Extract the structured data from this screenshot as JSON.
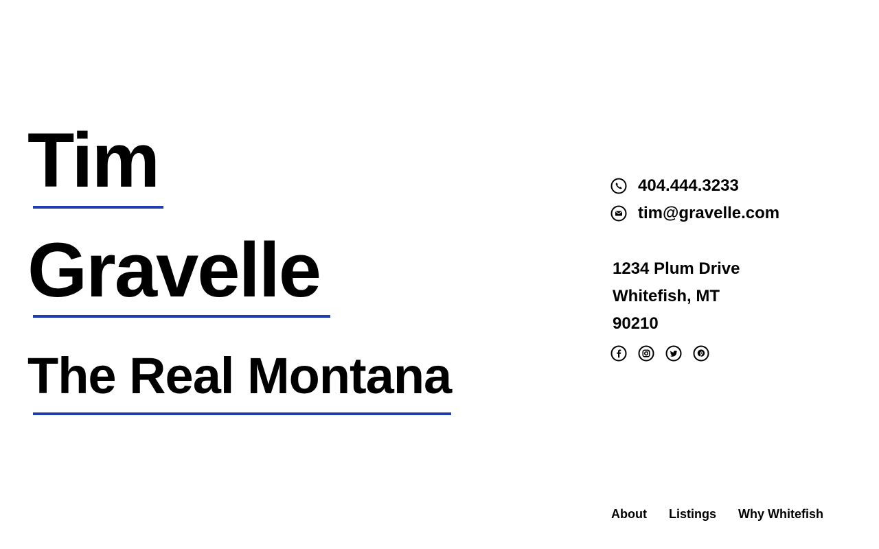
{
  "hero": {
    "first_name": "Tim",
    "last_name": "Gravelle",
    "tagline": "The Real Montana"
  },
  "contact": {
    "phone": "404.444.3233",
    "email": "tim@gravelle.com",
    "phone_icon": "phone-icon",
    "email_icon": "envelope-icon"
  },
  "address": {
    "street": "1234 Plum Drive",
    "city_state": "Whitefish, MT",
    "zip": "90210"
  },
  "social": {
    "icons": [
      "facebook-icon",
      "instagram-icon",
      "twitter-icon",
      "pinterest-icon"
    ]
  },
  "nav": {
    "items": [
      {
        "label": "About"
      },
      {
        "label": "Listings"
      },
      {
        "label": "Why Whitefish"
      }
    ]
  },
  "colors": {
    "accent": "#1f3fb0",
    "text": "#000000",
    "background": "#ffffff"
  }
}
